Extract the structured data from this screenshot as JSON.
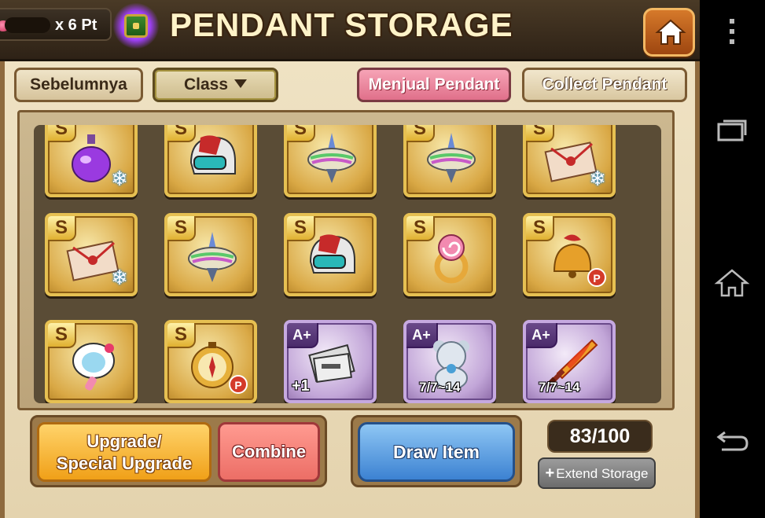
{
  "header": {
    "points_text": "x 6 Pt",
    "title": "PENDANT STORAGE",
    "home_icon": "home-icon"
  },
  "toolbar": {
    "prev_label": "Sebelumnya",
    "class_label": "Class",
    "sell_label": "Menjual Pendant",
    "collect_label": "Collect Pendant"
  },
  "grid": {
    "slots": [
      {
        "grade": "S",
        "item": "perfume-bottle",
        "badge": "snowflake",
        "label": ""
      },
      {
        "grade": "S",
        "item": "racing-helmet",
        "badge": "",
        "label": ""
      },
      {
        "grade": "S",
        "item": "spinning-top",
        "badge": "",
        "label": ""
      },
      {
        "grade": "S",
        "item": "spinning-top",
        "badge": "",
        "label": ""
      },
      {
        "grade": "S",
        "item": "gift-envelope",
        "badge": "snowflake",
        "label": ""
      },
      {
        "grade": "S",
        "item": "gift-envelope",
        "badge": "snowflake",
        "label": ""
      },
      {
        "grade": "S",
        "item": "spinning-top",
        "badge": "",
        "label": ""
      },
      {
        "grade": "S",
        "item": "racing-helmet",
        "badge": "",
        "label": ""
      },
      {
        "grade": "S",
        "item": "candy-ring",
        "badge": "",
        "label": ""
      },
      {
        "grade": "S",
        "item": "bell",
        "badge": "P",
        "label": ""
      },
      {
        "grade": "S",
        "item": "kitty-mirror",
        "badge": "",
        "label": ""
      },
      {
        "grade": "S",
        "item": "compass",
        "badge": "P",
        "label": ""
      },
      {
        "grade": "A+",
        "item": "gift-ticket",
        "badge": "",
        "label": "+1"
      },
      {
        "grade": "A+",
        "item": "teddy-bear",
        "badge": "",
        "label": "7/7~14"
      },
      {
        "grade": "A+",
        "item": "flame-sword",
        "badge": "",
        "label": "7/7~14"
      }
    ]
  },
  "actions": {
    "upgrade_label_line1": "Upgrade/",
    "upgrade_label_line2": "Special Upgrade",
    "combine_label": "Combine",
    "draw_label": "Draw Item",
    "capacity": "83/100",
    "extend_label": "Extend Storage"
  },
  "colors": {
    "sell_pink": "#e0708a",
    "draw_blue": "#3c82d2",
    "upgrade_orange": "#f0a018",
    "combine_red": "#ec6e66"
  }
}
